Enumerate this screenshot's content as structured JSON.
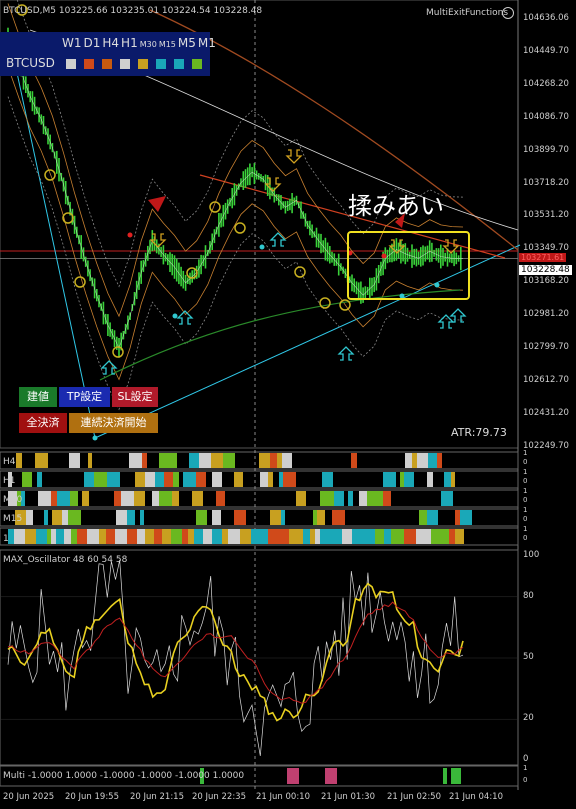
{
  "header": {
    "symbol_line": "BTCUSD,M5  103225.66 103235.01 103224.54 103228.48",
    "indicator_name": "MultiExitFunctions"
  },
  "timeframe_panel": {
    "labels": [
      "W1",
      "D1",
      "H4",
      "H1",
      "M30",
      "M15",
      "M5",
      "M1"
    ],
    "symbol": "BTCUSD",
    "square_colors": [
      "#cfcfcf",
      "#d04a1a",
      "#c85a10",
      "#cfcfcf",
      "#c8a020",
      "#1aa8b8",
      "#1aa8b8",
      "#6ab820"
    ]
  },
  "buttons": {
    "entry": "建値",
    "tp": "TP設定",
    "sl": "SL設定",
    "close_all": "全決済",
    "continuous_close": "連続決済開始"
  },
  "annotation": "揉みあい",
  "atr_label": "ATR:79.73",
  "price_axis": {
    "ticks": [
      "104636.06",
      "104449.70",
      "104268.20",
      "104086.70",
      "103899.70",
      "103718.20",
      "103531.20",
      "103349.70",
      "103168.20",
      "102981.20",
      "102799.70",
      "102612.70",
      "102431.20",
      "102249.70"
    ],
    "current_price": "103228.48",
    "current_price_color": "#ffffff",
    "red_price": "103271.61"
  },
  "bar_rows": {
    "labels": [
      "H4",
      "H1",
      "M30",
      "M15",
      "1"
    ],
    "scale_top": "1",
    "scale_bottom": "0"
  },
  "oscillator": {
    "title": "MAX_Oscillator 48 60 54 58",
    "ticks": [
      "100",
      "80",
      "50",
      "20",
      "0"
    ]
  },
  "multi_row": {
    "text": "Multi -1.0000 1.0000 -1.0000 -1.0000 -1.0000 1.0000",
    "scale_top": "1",
    "scale_bottom": "0"
  },
  "time_axis": {
    "labels": [
      "20 Jun 2025",
      "20 Jun 19:55",
      "20 Jun 21:15",
      "20 Jun 22:35",
      "21 Jun 00:10",
      "21 Jun 01:30",
      "21 Jun 02:50",
      "21 Jun 04:10"
    ]
  },
  "chart_data": {
    "type": "line",
    "title": "BTCUSD,M5",
    "ylim": [
      102150,
      104700
    ],
    "series": [
      {
        "name": "BTCUSD",
        "values": [
          104500,
          104320,
          104150,
          104020,
          103860,
          103650,
          103420,
          103210,
          103020,
          102850,
          102720,
          102900,
          103150,
          103330,
          103250,
          103180,
          103090,
          103150,
          103260,
          103420,
          103550,
          103660,
          103720,
          103680,
          103590,
          103520,
          103560,
          103420,
          103330,
          103250,
          103180,
          103090,
          103020,
          103080,
          103230,
          103280,
          103250,
          103230,
          103270,
          103240,
          103230,
          103228
        ]
      }
    ]
  }
}
